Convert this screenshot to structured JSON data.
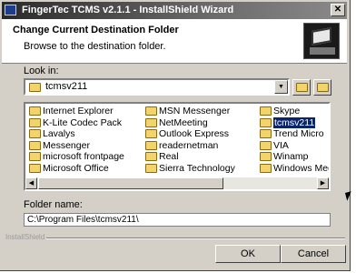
{
  "titlebar": {
    "title": "FingerTec TCMS v2.1.1 - InstallShield Wizard",
    "close_glyph": "✕"
  },
  "header": {
    "title": "Change Current Destination Folder",
    "subtitle": "Browse to the destination folder.",
    "logo_icon": "computer-install-icon"
  },
  "lookin": {
    "label": "Look in:",
    "value": "tcmsv211"
  },
  "toolbar": {
    "up_icon": "folder-up-icon",
    "new_icon": "new-folder-icon"
  },
  "filelist": {
    "columns": [
      [
        "Internet Explorer",
        "K-Lite Codec Pack",
        "Lavalys",
        "Messenger",
        "microsoft frontpage",
        "Microsoft Office"
      ],
      [
        "MSN Messenger",
        "NetMeeting",
        "Outlook Express",
        "readernetman",
        "Real",
        "Sierra Technology"
      ],
      [
        "Skype",
        "tcmsv211",
        "Trend Micro",
        "VIA",
        "Winamp",
        "Windows Media F"
      ]
    ],
    "selected": "tcmsv211"
  },
  "folder_name": {
    "label": "Folder name:",
    "value": "C:\\Program Files\\tcmsv211\\"
  },
  "footer": {
    "brand": "InstallShield"
  },
  "buttons": {
    "ok": "OK",
    "cancel": "Cancel"
  }
}
